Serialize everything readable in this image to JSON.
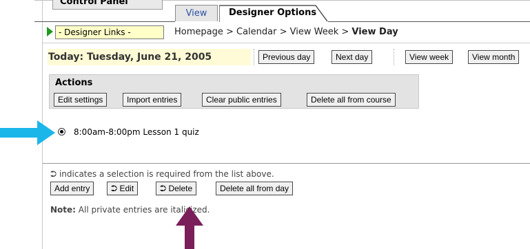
{
  "control_panel": {
    "label": "Control Panel"
  },
  "tabs": {
    "view": "View",
    "designer_options": "Designer Options"
  },
  "designer_links": {
    "value": "- Designer Links -"
  },
  "breadcrumb": {
    "path": "Homepage > Calendar > View Week > ",
    "current": "View Day"
  },
  "today": {
    "label": "Today: Tuesday, June 21, 2005"
  },
  "nav": {
    "previous_day": "Previous day",
    "next_day": "Next day",
    "view_week": "View week",
    "view_month": "View month"
  },
  "actions": {
    "title": "Actions",
    "edit_settings": "Edit settings",
    "import_entries": "Import entries",
    "clear_public_entries": "Clear public entries",
    "delete_all_from_course": "Delete all from course"
  },
  "entries": [
    {
      "text": "8:00am-8:00pm Lesson 1 quiz",
      "selected": true
    }
  ],
  "hint": {
    "text": "indicates a selection is required from the list above."
  },
  "entry_buttons": {
    "add_entry": "Add entry",
    "edit": "Edit",
    "delete": "Delete",
    "delete_all_from_day": "Delete all from day"
  },
  "note": {
    "label": "Note:",
    "text": "All private entries are italicized."
  },
  "colors": {
    "cyan_arrow": "#1ab6ea",
    "purple_arrow": "#7a1f5a",
    "today_bg": "#fffbd6",
    "link_field_bg": "#ffffc8",
    "green_marker": "#1f9a1f"
  }
}
